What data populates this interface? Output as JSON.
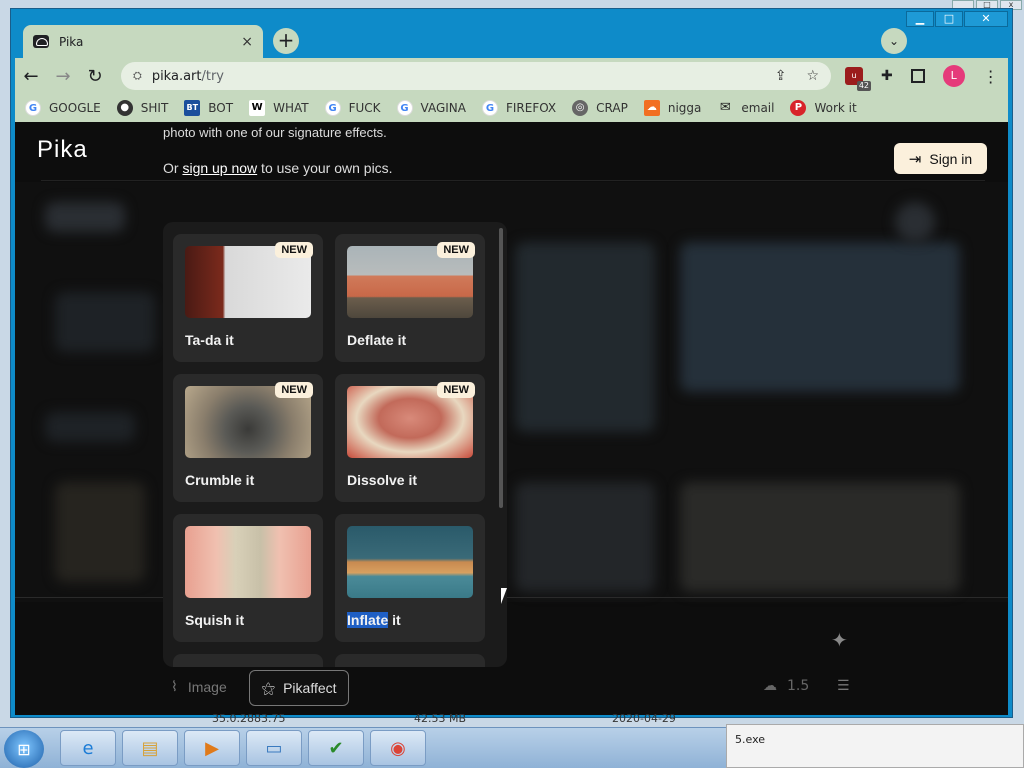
{
  "browser": {
    "tab_title": "Pika",
    "tab_close": "×",
    "new_tab": "+",
    "tab_search": "⌄",
    "url_host": "pika.art",
    "url_path": "/try",
    "ext_badge": "42",
    "avatar_letter": "L",
    "window_controls": {
      "minimize": "▁",
      "maximize": "□",
      "close": "✕"
    }
  },
  "bookmarks": [
    {
      "label": "GOOGLE",
      "icon": "google-icon"
    },
    {
      "label": "SHIT",
      "icon": "bookmark-icon"
    },
    {
      "label": "BOT",
      "icon": "bt-icon"
    },
    {
      "label": "WHAT",
      "icon": "w-icon"
    },
    {
      "label": "FUCK",
      "icon": "google-icon"
    },
    {
      "label": "VAGINA",
      "icon": "google-icon"
    },
    {
      "label": "FIREFOX",
      "icon": "google-icon"
    },
    {
      "label": "CRAP",
      "icon": "globe-icon"
    },
    {
      "label": "nigga",
      "icon": "soundcloud-icon"
    },
    {
      "label": "email",
      "icon": "mail-icon"
    },
    {
      "label": "Work it",
      "icon": "pinterest-icon"
    }
  ],
  "page": {
    "logo": "Pika",
    "intro_partial": "photo with one of our signature effects.",
    "intro_prefix": "Or ",
    "intro_link": "sign up now",
    "intro_suffix": " to use your own pics.",
    "signin": "Sign in",
    "image_label": "Image",
    "pikaffect_label": "Pikaffect",
    "credits": "1.5"
  },
  "effects": {
    "new_badge": "NEW",
    "items": [
      {
        "label": "Ta-da it",
        "new": true
      },
      {
        "label": "Deflate it",
        "new": true
      },
      {
        "label": "Crumble it",
        "new": true
      },
      {
        "label": "Dissolve it",
        "new": true
      },
      {
        "label": "Squish it",
        "new": false
      },
      {
        "label": "Inflate it",
        "new": false,
        "highlight": "Inflate",
        "rest": " it"
      }
    ]
  },
  "desktop": {
    "bg_text_1": "35.0.2883.75",
    "bg_text_2": "42.53 MB",
    "bg_text_3": "2020-04-29",
    "notification": "5.exe"
  },
  "colors": {
    "chrome_frame": "#0e8bc9",
    "chrome_toolbar": "#c6d9bf",
    "accent_button": "#fbf0dc",
    "selection": "#1f5fc4"
  }
}
